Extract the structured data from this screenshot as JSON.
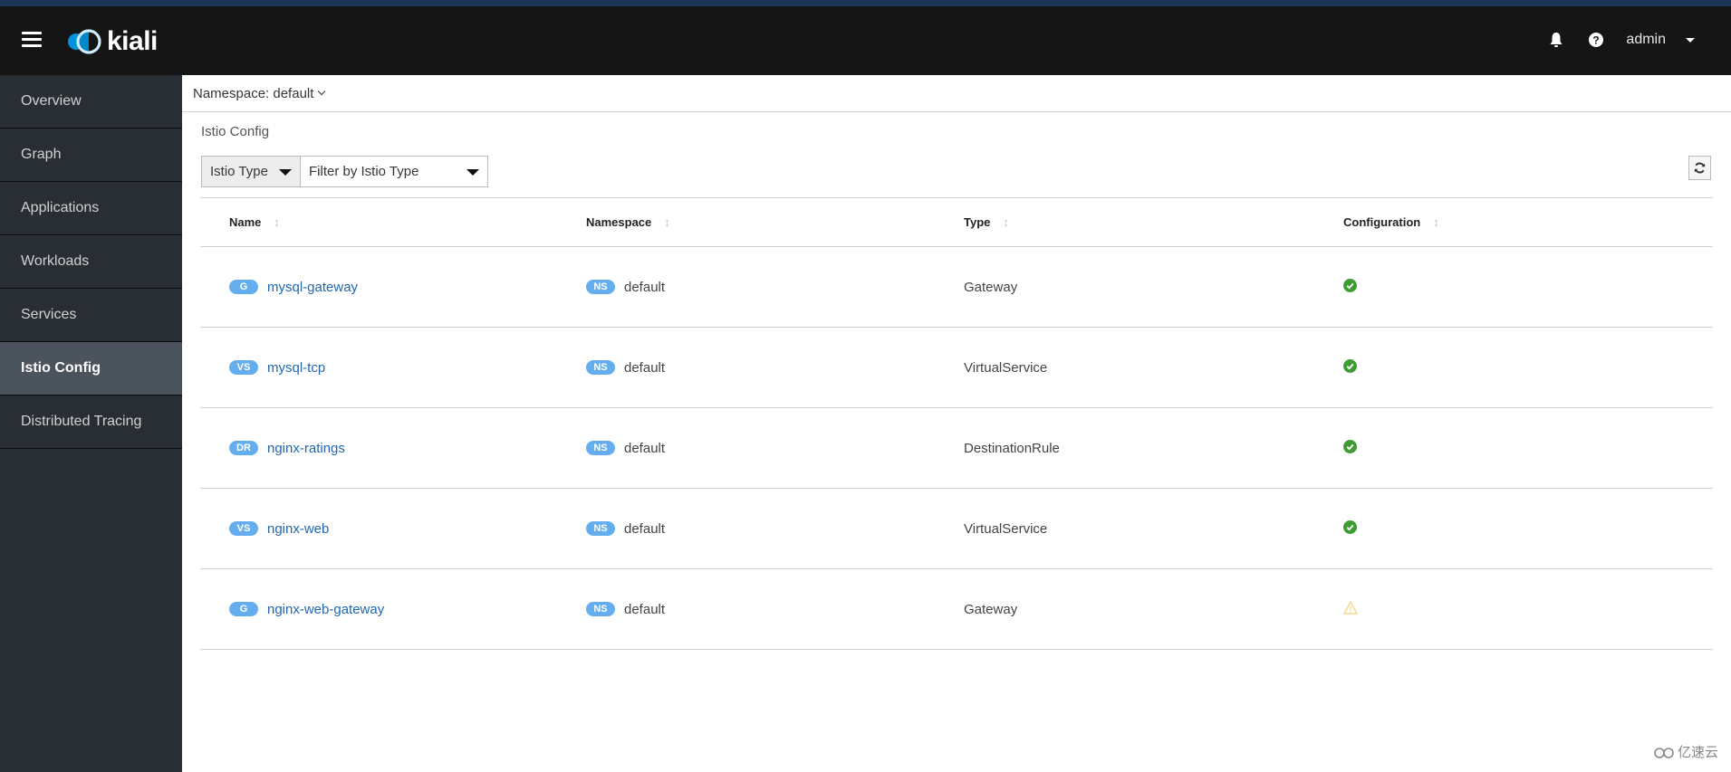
{
  "masthead": {
    "brand": "kiali",
    "user": "admin",
    "icons": {
      "menu": "hamburger-icon",
      "notifications": "bell-icon",
      "help": "question-circle-icon",
      "user_menu": "caret-down-icon"
    }
  },
  "sidebar": {
    "items": [
      {
        "label": "Overview",
        "active": false
      },
      {
        "label": "Graph",
        "active": false
      },
      {
        "label": "Applications",
        "active": false
      },
      {
        "label": "Workloads",
        "active": false
      },
      {
        "label": "Services",
        "active": false
      },
      {
        "label": "Istio Config",
        "active": true
      },
      {
        "label": "Distributed Tracing",
        "active": false
      }
    ]
  },
  "namespace_selector": {
    "label": "Namespace: default"
  },
  "page": {
    "title": "Istio Config"
  },
  "filter": {
    "type_label": "Istio Type",
    "placeholder": "Filter by Istio Type",
    "refresh_icon": "refresh-icon"
  },
  "table": {
    "columns": [
      "Name",
      "Namespace",
      "Type",
      "Configuration"
    ],
    "rows": [
      {
        "badge": "G",
        "name": "mysql-gateway",
        "ns_badge": "NS",
        "namespace": "default",
        "type": "Gateway",
        "config": "valid"
      },
      {
        "badge": "VS",
        "name": "mysql-tcp",
        "ns_badge": "NS",
        "namespace": "default",
        "type": "VirtualService",
        "config": "valid"
      },
      {
        "badge": "DR",
        "name": "nginx-ratings",
        "ns_badge": "NS",
        "namespace": "default",
        "type": "DestinationRule",
        "config": "valid"
      },
      {
        "badge": "VS",
        "name": "nginx-web",
        "ns_badge": "NS",
        "namespace": "default",
        "type": "VirtualService",
        "config": "valid"
      },
      {
        "badge": "G",
        "name": "nginx-web-gateway",
        "ns_badge": "NS",
        "namespace": "default",
        "type": "Gateway",
        "config": "warning"
      }
    ]
  },
  "colors": {
    "masthead": "#151515",
    "sidebar": "#292e34",
    "sidebar_active": "#4b535c",
    "badge": "#64aeef",
    "link": "#1f67b1",
    "ok": "#3f9c35",
    "warning": "#f0ab00"
  },
  "watermark": {
    "text": "亿速云"
  }
}
